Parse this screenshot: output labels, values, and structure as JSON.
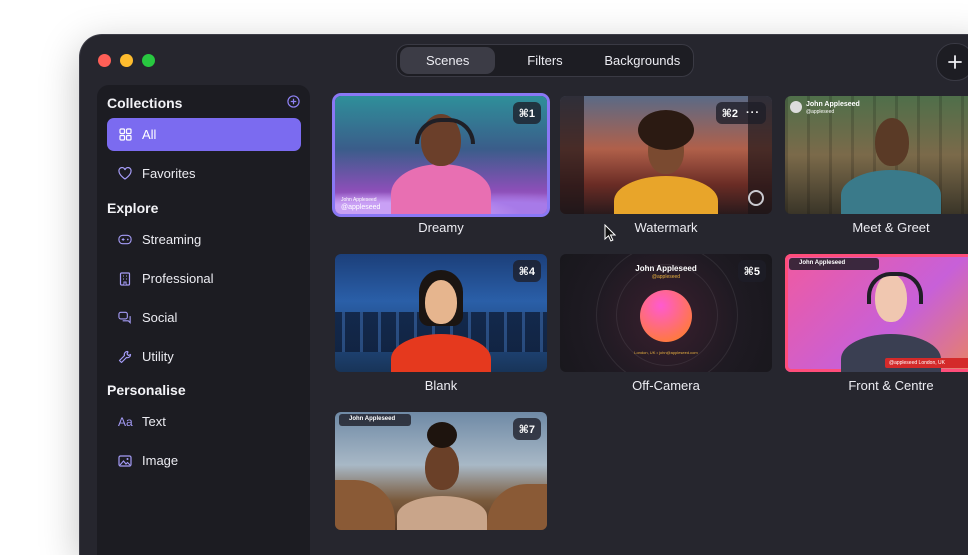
{
  "tabs": {
    "scenes": "Scenes",
    "filters": "Filters",
    "backgrounds": "Backgrounds"
  },
  "sidebar": {
    "collections_title": "Collections",
    "explore_title": "Explore",
    "personalise_title": "Personalise",
    "items": [
      {
        "label": "All",
        "icon": "grid-icon"
      },
      {
        "label": "Favorites",
        "icon": "heart-icon"
      },
      {
        "label": "Streaming",
        "icon": "gamepad-icon"
      },
      {
        "label": "Professional",
        "icon": "building-icon"
      },
      {
        "label": "Social",
        "icon": "chat-bubbles-icon"
      },
      {
        "label": "Utility",
        "icon": "wrench-icon"
      },
      {
        "label": "Text",
        "icon": "text-aa-icon",
        "glyph": "Aa"
      },
      {
        "label": "Image",
        "icon": "image-icon"
      }
    ]
  },
  "scenes": [
    {
      "name": "Dreamy",
      "shortcut": "⌘1",
      "overlay_name": "John Appleseed",
      "overlay_handle": "@appleseed"
    },
    {
      "name": "Watermark",
      "shortcut": "⌘2",
      "more": "···"
    },
    {
      "name": "Meet & Greet",
      "overlay_name": "John Appleseed",
      "overlay_handle": "@appleseed"
    },
    {
      "name": "Blank",
      "shortcut": "⌘4"
    },
    {
      "name": "Off-Camera",
      "shortcut": "⌘5",
      "overlay_name": "John Appleseed",
      "overlay_handle": "@appleseed",
      "overlay_footer": "London, UK • john@appleseed.com"
    },
    {
      "name": "Front & Centre",
      "overlay_name": "John Appleseed",
      "overlay_footer": "@appleseed London, UK"
    },
    {
      "name": "",
      "shortcut": "⌘7",
      "overlay_name": "John Appleseed"
    }
  ],
  "colors": {
    "accent": "#7b6bf0",
    "window_bg": "#26262e",
    "sidebar_bg": "#1c1c22"
  }
}
